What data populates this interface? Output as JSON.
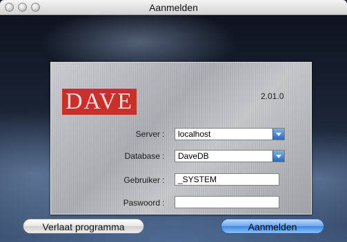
{
  "window": {
    "title": "Aanmelden"
  },
  "logo": {
    "text": "DAVE"
  },
  "version": "2.01.0",
  "form": {
    "server": {
      "label": "Server",
      "value": "localhost"
    },
    "database": {
      "label": "Database",
      "value": "DaveDB"
    },
    "user": {
      "label": "Gebruiker",
      "value": "_SYSTEM"
    },
    "password": {
      "label": "Paswoord",
      "value": ""
    }
  },
  "buttons": {
    "quit": "Verlaat programma",
    "login": "Aanmelden"
  },
  "colors": {
    "logo_red": "#c9302c",
    "default_button": "#3f86e0"
  },
  "icons": [
    "close-icon",
    "minimize-icon",
    "zoom-icon",
    "chevron-down-icon"
  ]
}
